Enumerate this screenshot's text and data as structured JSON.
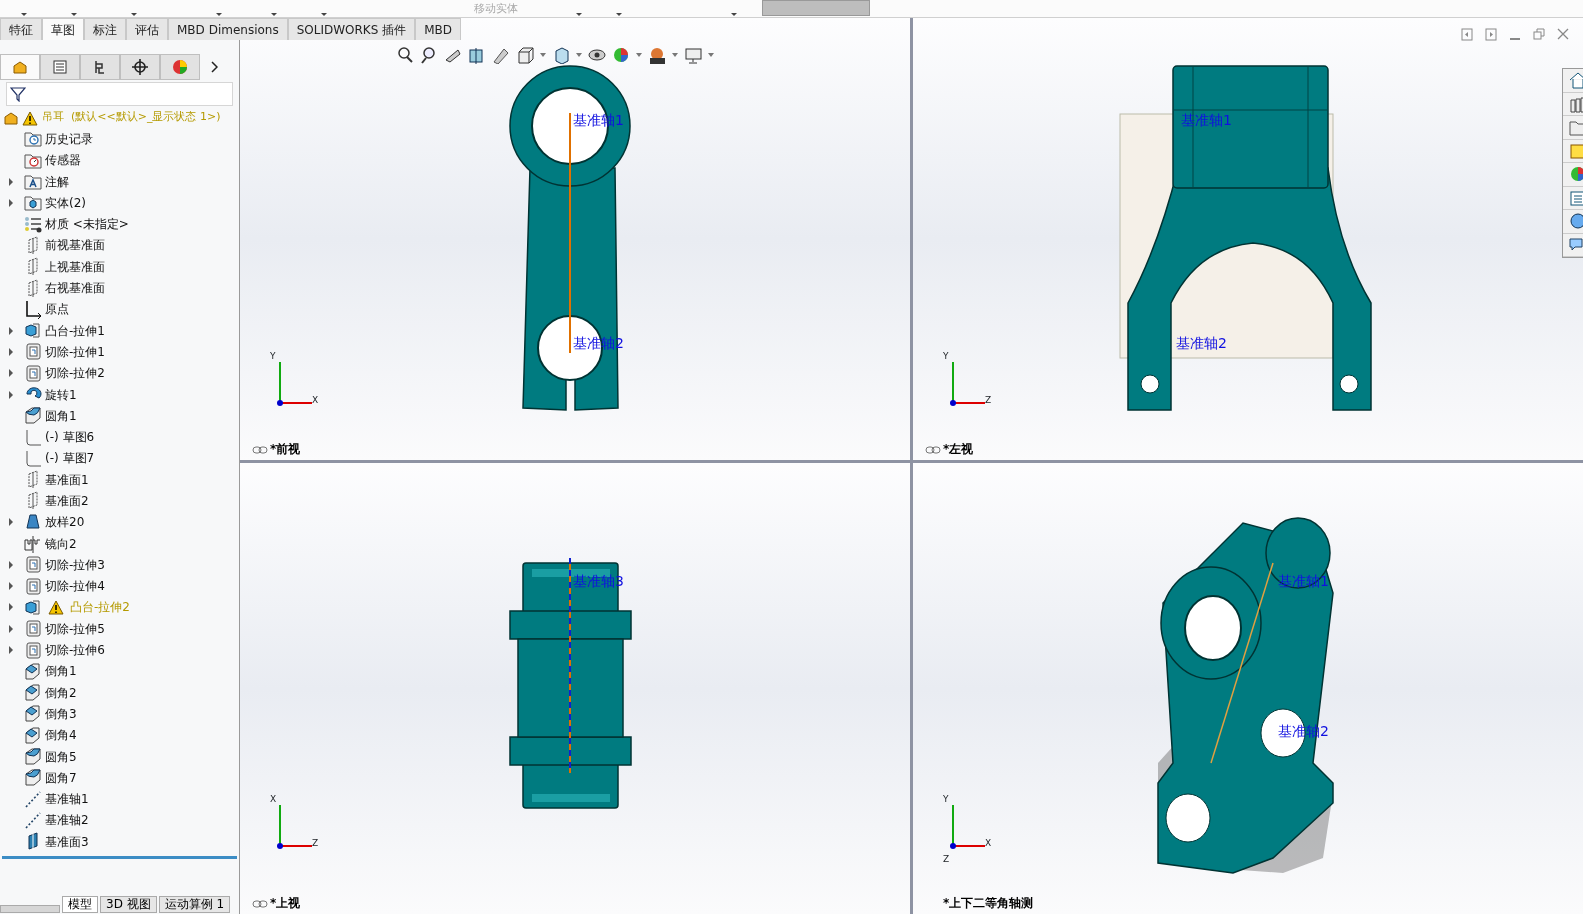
{
  "top_strip": {
    "greyed_command": "移动实体"
  },
  "command_tabs": [
    {
      "label": "特征",
      "selected": false
    },
    {
      "label": "草图",
      "selected": true
    },
    {
      "label": "标注",
      "selected": false
    },
    {
      "label": "评估",
      "selected": false
    },
    {
      "label": "MBD Dimensions",
      "selected": false
    },
    {
      "label": "SOLIDWORKS 插件",
      "selected": false
    },
    {
      "label": "MBD",
      "selected": false
    }
  ],
  "panel_tabs": [
    {
      "kind": "feature",
      "selected": true
    },
    {
      "kind": "property",
      "selected": false
    },
    {
      "kind": "config",
      "selected": false
    },
    {
      "kind": "dimxpert",
      "selected": false
    },
    {
      "kind": "display",
      "selected": false
    }
  ],
  "tree": {
    "label": "吊耳  (默认<<默认>_显示状态 1>)",
    "warning": true,
    "children": [
      {
        "label": "历史记录",
        "kind": "history",
        "expandable": false,
        "warning": false
      },
      {
        "label": "传感器",
        "kind": "sensor",
        "expandable": false,
        "warning": false
      },
      {
        "label": "注解",
        "kind": "annotation",
        "expandable": true,
        "warning": false
      },
      {
        "label": "实体(2)",
        "kind": "solid",
        "expandable": true,
        "warning": false
      },
      {
        "label": "材质 <未指定>",
        "kind": "material",
        "expandable": false,
        "warning": false
      },
      {
        "label": "前视基准面",
        "kind": "plane",
        "expandable": false,
        "warning": false
      },
      {
        "label": "上视基准面",
        "kind": "plane",
        "expandable": false,
        "warning": false
      },
      {
        "label": "右视基准面",
        "kind": "plane",
        "expandable": false,
        "warning": false
      },
      {
        "label": "原点",
        "kind": "origin",
        "expandable": false,
        "warning": false
      },
      {
        "label": "凸台-拉伸1",
        "kind": "boss",
        "expandable": true,
        "warning": false
      },
      {
        "label": "切除-拉伸1",
        "kind": "cut",
        "expandable": true,
        "warning": false
      },
      {
        "label": "切除-拉伸2",
        "kind": "cut",
        "expandable": true,
        "warning": false
      },
      {
        "label": "旋转1",
        "kind": "revolve",
        "expandable": true,
        "warning": false
      },
      {
        "label": "圆角1",
        "kind": "fillet",
        "expandable": false,
        "warning": false
      },
      {
        "label": "(-) 草图6",
        "kind": "sketch",
        "expandable": false,
        "warning": false
      },
      {
        "label": "(-) 草图7",
        "kind": "sketch",
        "expandable": false,
        "warning": false
      },
      {
        "label": "基准面1",
        "kind": "plane",
        "expandable": false,
        "warning": false
      },
      {
        "label": "基准面2",
        "kind": "plane",
        "expandable": false,
        "warning": false
      },
      {
        "label": "放样20",
        "kind": "loft",
        "expandable": true,
        "warning": false
      },
      {
        "label": "镜向2",
        "kind": "mirror",
        "expandable": false,
        "warning": false
      },
      {
        "label": "切除-拉伸3",
        "kind": "cut",
        "expandable": true,
        "warning": false
      },
      {
        "label": "切除-拉伸4",
        "kind": "cut",
        "expandable": true,
        "warning": false
      },
      {
        "label": "凸台-拉伸2",
        "kind": "boss",
        "expandable": true,
        "warning": true
      },
      {
        "label": "切除-拉伸5",
        "kind": "cut",
        "expandable": true,
        "warning": false
      },
      {
        "label": "切除-拉伸6",
        "kind": "cut",
        "expandable": true,
        "warning": false
      },
      {
        "label": "倒角1",
        "kind": "chamfer",
        "expandable": false,
        "warning": false
      },
      {
        "label": "倒角2",
        "kind": "chamfer",
        "expandable": false,
        "warning": false
      },
      {
        "label": "倒角3",
        "kind": "chamfer",
        "expandable": false,
        "warning": false
      },
      {
        "label": "倒角4",
        "kind": "chamfer",
        "expandable": false,
        "warning": false
      },
      {
        "label": "圆角5",
        "kind": "fillet",
        "expandable": false,
        "warning": false
      },
      {
        "label": "圆角7",
        "kind": "fillet",
        "expandable": false,
        "warning": false
      },
      {
        "label": "基准轴1",
        "kind": "axis",
        "expandable": false,
        "warning": false
      },
      {
        "label": "基准轴2",
        "kind": "axis",
        "expandable": false,
        "warning": false
      },
      {
        "label": "基准面3",
        "kind": "plane-solid",
        "expandable": false,
        "warning": false
      }
    ]
  },
  "bottom_tabs": [
    {
      "label": "模型",
      "selected": true
    },
    {
      "label": "3D 视图",
      "selected": false
    },
    {
      "label": "运动算例 1",
      "selected": false
    }
  ],
  "viewports": [
    {
      "kind": "front",
      "label": "*前视",
      "axis_labels": [
        "基准轴1",
        "基准轴2"
      ],
      "triad": [
        "Y",
        "X"
      ]
    },
    {
      "kind": "left",
      "label": "*左视",
      "axis_labels": [
        "基准轴1",
        "基准轴2"
      ],
      "triad": [
        "Y",
        "Z"
      ]
    },
    {
      "kind": "top",
      "label": "*上视",
      "axis_labels": [
        "基准轴3"
      ],
      "triad": [
        "X",
        "Z"
      ]
    },
    {
      "kind": "iso",
      "label": "*上下二等角轴测",
      "axis_labels": [
        "基准轴1",
        "基准轴2"
      ],
      "triad": [
        "Y",
        "X",
        "Z"
      ]
    }
  ]
}
